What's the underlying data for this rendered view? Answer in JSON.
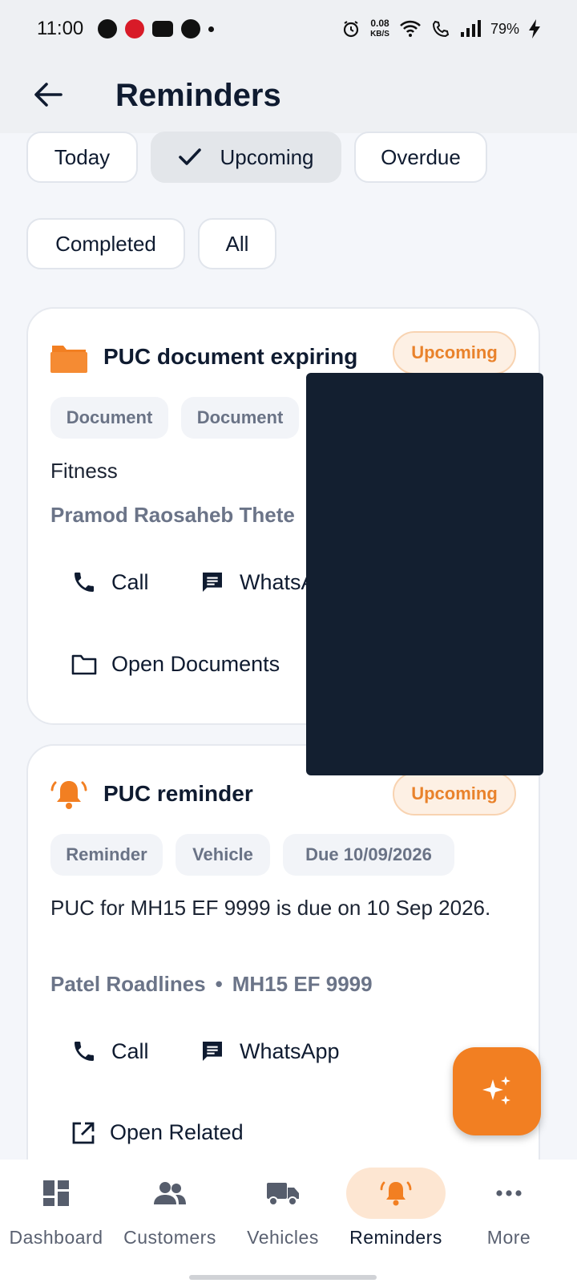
{
  "status_bar": {
    "time": "11:00",
    "net_speed_value": "0.08",
    "net_speed_unit": "KB/S",
    "battery": "79%"
  },
  "app_bar": {
    "title": "Reminders",
    "back_icon": "arrow-left-icon"
  },
  "filters": [
    {
      "label": "Today",
      "selected": false
    },
    {
      "label": "Upcoming",
      "selected": true
    },
    {
      "label": "Overdue",
      "selected": false
    },
    {
      "label": "Completed",
      "selected": false
    },
    {
      "label": "All",
      "selected": false
    }
  ],
  "cards": [
    {
      "icon": "folder-icon",
      "title": "PUC document expiring",
      "status": "Upcoming",
      "tags": [
        "Document",
        "Document"
      ],
      "description": "Fitness",
      "meta": "Pramod Raosaheb Thete",
      "actions": [
        "Call",
        "WhatsA",
        "Open Documents"
      ]
    },
    {
      "icon": "bell-icon",
      "title": "PUC reminder",
      "status": "Upcoming",
      "tags": [
        "Reminder",
        "Vehicle",
        "Due 10/09/2026"
      ],
      "description": "PUC for MH15 EF 9999 is due on 10 Sep 2026.",
      "meta_name": "Patel Roadlines",
      "meta_separator": "•",
      "meta_vehicle": "MH15 EF 9999",
      "actions": [
        "Call",
        "WhatsApp",
        "Open Related"
      ]
    }
  ],
  "nav": [
    {
      "label": "Dashboard",
      "icon": "dashboard-icon",
      "active": false
    },
    {
      "label": "Customers",
      "icon": "customers-icon",
      "active": false
    },
    {
      "label": "Vehicles",
      "icon": "truck-icon",
      "active": false
    },
    {
      "label": "Reminders",
      "icon": "bell-icon",
      "active": true
    },
    {
      "label": "More",
      "icon": "more-icon",
      "active": false
    }
  ],
  "colors": {
    "accent": "#f27f22",
    "navy": "#0f1b30",
    "pill_bg": "#fdf0e4"
  }
}
